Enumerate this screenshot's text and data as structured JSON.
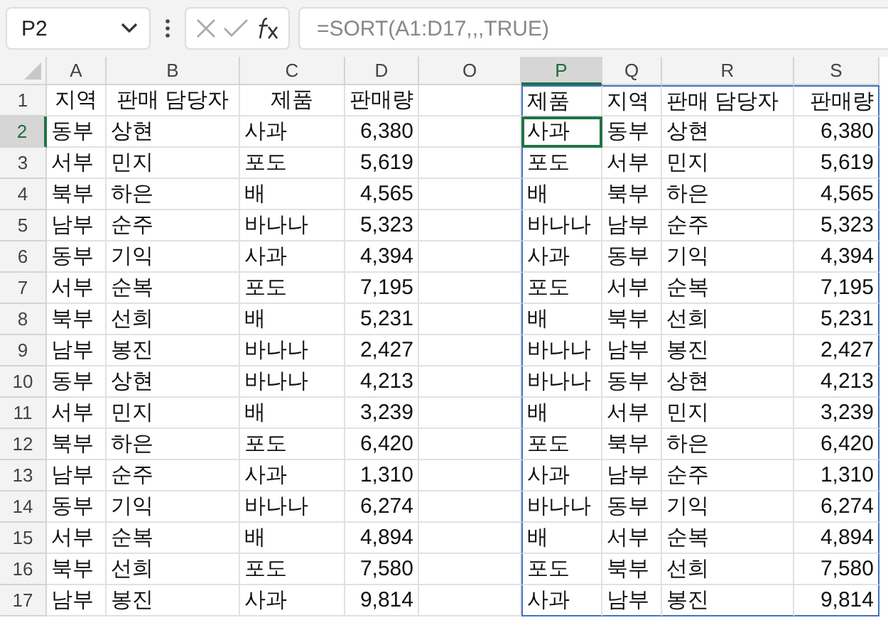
{
  "name_box": {
    "value": "P2"
  },
  "formula_bar": {
    "value": "=SORT(A1:D17,,,TRUE)"
  },
  "columns": [
    {
      "letter": "A",
      "selected": false,
      "kind": "text"
    },
    {
      "letter": "B",
      "selected": false,
      "kind": "text"
    },
    {
      "letter": "C",
      "selected": false,
      "kind": "text"
    },
    {
      "letter": "D",
      "selected": false,
      "kind": "number"
    },
    {
      "letter": "O",
      "selected": false,
      "kind": "empty"
    },
    {
      "letter": "P",
      "selected": true,
      "kind": "spill"
    },
    {
      "letter": "Q",
      "selected": false,
      "kind": "spill"
    },
    {
      "letter": "R",
      "selected": false,
      "kind": "spill"
    },
    {
      "letter": "S",
      "selected": false,
      "kind": "spill-number"
    }
  ],
  "rows": [
    {
      "number": "1",
      "selected": false,
      "cells": [
        "지역",
        "판매 담당자",
        "제품",
        "판매량",
        "",
        "제품",
        "지역",
        "판매 담당자",
        "판매량"
      ]
    },
    {
      "number": "2",
      "selected": true,
      "cells": [
        "동부",
        "상현",
        "사과",
        "6,380",
        "",
        "사과",
        "동부",
        "상현",
        "6,380"
      ]
    },
    {
      "number": "3",
      "selected": false,
      "cells": [
        "서부",
        "민지",
        "포도",
        "5,619",
        "",
        "포도",
        "서부",
        "민지",
        "5,619"
      ]
    },
    {
      "number": "4",
      "selected": false,
      "cells": [
        "북부",
        "하은",
        "배",
        "4,565",
        "",
        "배",
        "북부",
        "하은",
        "4,565"
      ]
    },
    {
      "number": "5",
      "selected": false,
      "cells": [
        "남부",
        "순주",
        "바나나",
        "5,323",
        "",
        "바나나",
        "남부",
        "순주",
        "5,323"
      ]
    },
    {
      "number": "6",
      "selected": false,
      "cells": [
        "동부",
        "기익",
        "사과",
        "4,394",
        "",
        "사과",
        "동부",
        "기익",
        "4,394"
      ]
    },
    {
      "number": "7",
      "selected": false,
      "cells": [
        "서부",
        "순복",
        "포도",
        "7,195",
        "",
        "포도",
        "서부",
        "순복",
        "7,195"
      ]
    },
    {
      "number": "8",
      "selected": false,
      "cells": [
        "북부",
        "선희",
        "배",
        "5,231",
        "",
        "배",
        "북부",
        "선희",
        "5,231"
      ]
    },
    {
      "number": "9",
      "selected": false,
      "cells": [
        "남부",
        "봉진",
        "바나나",
        "2,427",
        "",
        "바나나",
        "남부",
        "봉진",
        "2,427"
      ]
    },
    {
      "number": "10",
      "selected": false,
      "cells": [
        "동부",
        "상현",
        "바나나",
        "4,213",
        "",
        "바나나",
        "동부",
        "상현",
        "4,213"
      ]
    },
    {
      "number": "11",
      "selected": false,
      "cells": [
        "서부",
        "민지",
        "배",
        "3,239",
        "",
        "배",
        "서부",
        "민지",
        "3,239"
      ]
    },
    {
      "number": "12",
      "selected": false,
      "cells": [
        "북부",
        "하은",
        "포도",
        "6,420",
        "",
        "포도",
        "북부",
        "하은",
        "6,420"
      ]
    },
    {
      "number": "13",
      "selected": false,
      "cells": [
        "남부",
        "순주",
        "사과",
        "1,310",
        "",
        "사과",
        "남부",
        "순주",
        "1,310"
      ]
    },
    {
      "number": "14",
      "selected": false,
      "cells": [
        "동부",
        "기익",
        "바나나",
        "6,274",
        "",
        "바나나",
        "동부",
        "기익",
        "6,274"
      ]
    },
    {
      "number": "15",
      "selected": false,
      "cells": [
        "서부",
        "순복",
        "배",
        "4,894",
        "",
        "배",
        "서부",
        "순복",
        "4,894"
      ]
    },
    {
      "number": "16",
      "selected": false,
      "cells": [
        "북부",
        "선희",
        "포도",
        "7,580",
        "",
        "포도",
        "북부",
        "선희",
        "7,580"
      ]
    },
    {
      "number": "17",
      "selected": false,
      "cells": [
        "남부",
        "봉진",
        "사과",
        "9,814",
        "",
        "사과",
        "남부",
        "봉진",
        "9,814"
      ]
    }
  ]
}
